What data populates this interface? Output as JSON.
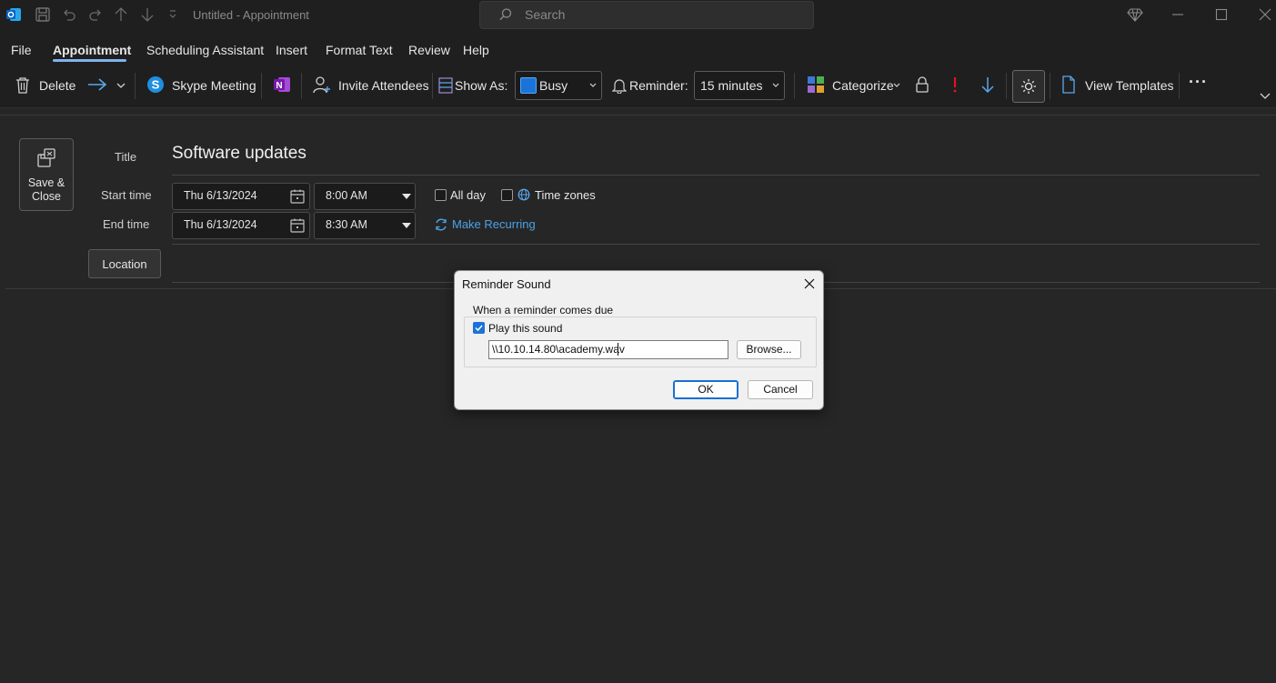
{
  "window": {
    "title": "Untitled  -  Appointment",
    "search_placeholder": "Search"
  },
  "menu": {
    "items": [
      {
        "label": "File",
        "active": false
      },
      {
        "label": "Appointment",
        "active": true
      },
      {
        "label": "Scheduling Assistant",
        "active": false
      },
      {
        "label": "Insert",
        "active": false
      },
      {
        "label": "Format Text",
        "active": false
      },
      {
        "label": "Review",
        "active": false
      },
      {
        "label": "Help",
        "active": false
      }
    ]
  },
  "ribbon": {
    "delete": "Delete",
    "skype_meeting": "Skype Meeting",
    "invite_attendees": "Invite Attendees",
    "show_as_label": "Show As:",
    "show_as_value": "Busy",
    "reminder_label": "Reminder:",
    "reminder_value": "15 minutes",
    "categorize": "Categorize",
    "view_templates": "View Templates",
    "more": "···"
  },
  "form": {
    "save_close": "Save &\nClose",
    "title_label": "Title",
    "title_value": "Software updates",
    "start_label": "Start time",
    "start_date": "Thu 6/13/2024",
    "start_time": "8:00 AM",
    "end_label": "End time",
    "end_date": "Thu 6/13/2024",
    "end_time": "8:30 AM",
    "all_day": "All day",
    "time_zones": "Time zones",
    "make_recurring": "Make Recurring",
    "location": "Location"
  },
  "dialog": {
    "title": "Reminder Sound",
    "group_label": "When a reminder comes due",
    "play_sound_label": "Play this sound",
    "play_sound_checked": true,
    "sound_path": "\\\\10.10.14.80\\academy.wav",
    "browse": "Browse...",
    "ok": "OK",
    "cancel": "Cancel"
  },
  "colors": {
    "accent": "#4aa3e8",
    "busy": "#1a73d9",
    "importance_high": "#e81123",
    "onenote": "#7719aa"
  }
}
